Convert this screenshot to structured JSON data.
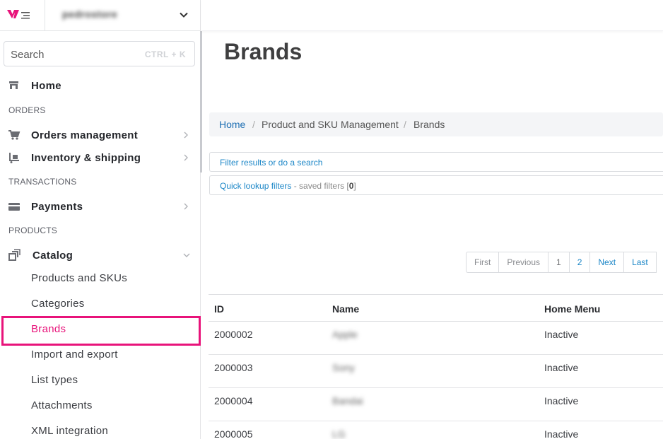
{
  "store": {
    "name": "pedrostore"
  },
  "search": {
    "placeholder": "Search",
    "shortcut": "CTRL + K"
  },
  "sidebar": {
    "home": "Home",
    "sections": {
      "orders": "ORDERS",
      "transactions": "TRANSACTIONS",
      "products": "PRODUCTS"
    },
    "orders_management": "Orders management",
    "inventory_shipping": "Inventory & shipping",
    "payments": "Payments",
    "catalog": "Catalog",
    "catalog_items": [
      "Products and SKUs",
      "Categories",
      "Brands",
      "Import and export",
      "List types",
      "Attachments",
      "XML integration"
    ],
    "selected_item": "Brands"
  },
  "page": {
    "title": "Brands"
  },
  "breadcrumb": [
    "Home",
    "Product and SKU Management",
    "Brands"
  ],
  "filters": {
    "search_link": "Filter results or do a search",
    "quick_lookup_link": "Quick lookup filters",
    "saved_prefix": " - saved filters [",
    "saved_count": "0",
    "saved_suffix": "]"
  },
  "pagination": {
    "first": "First",
    "previous": "Previous",
    "pages": [
      "1",
      "2"
    ],
    "current_page": "1",
    "next": "Next",
    "last": "Last"
  },
  "table": {
    "headers": [
      "ID",
      "Name",
      "Home Menu"
    ],
    "rows": [
      {
        "id": "2000002",
        "name": "Apple",
        "home_menu": "Inactive"
      },
      {
        "id": "2000003",
        "name": "Sony",
        "home_menu": "Inactive"
      },
      {
        "id": "2000004",
        "name": "Bandai",
        "home_menu": "Inactive"
      },
      {
        "id": "2000005",
        "name": "LG",
        "home_menu": "Inactive"
      }
    ]
  },
  "colors": {
    "accent": "#e8137a",
    "link": "#1b86c7",
    "breadcrumb_link": "#1e6fb3"
  }
}
